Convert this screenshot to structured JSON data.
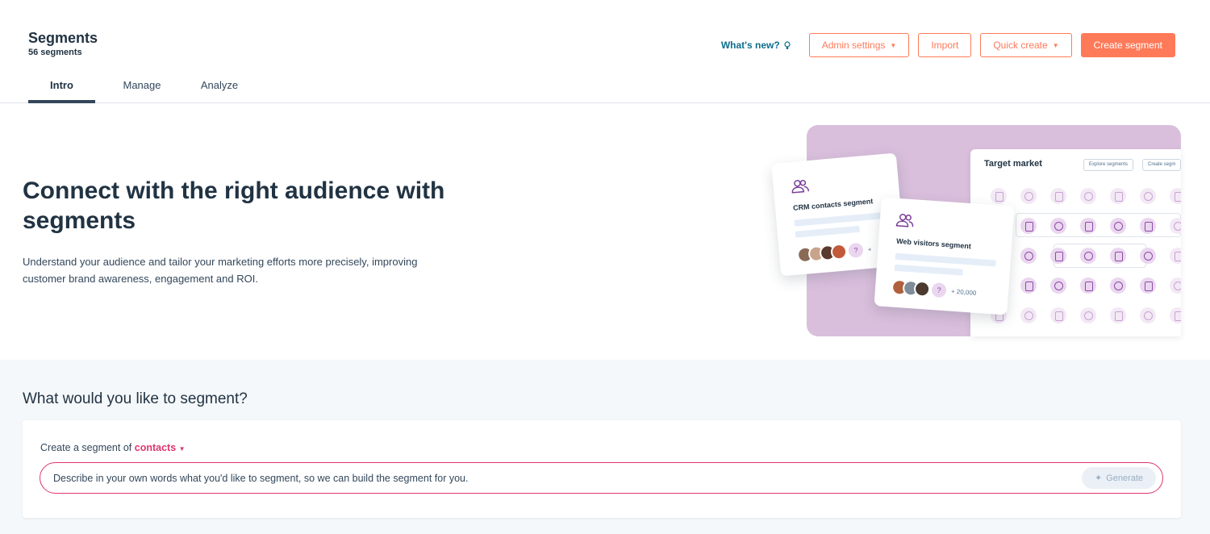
{
  "header": {
    "title": "Segments",
    "subtitle": "56 segments",
    "whats_new": "What's new?",
    "admin_settings": "Admin settings",
    "import": "Import",
    "quick_create": "Quick create",
    "create_segment": "Create segment"
  },
  "tabs": [
    {
      "label": "Intro",
      "active": true
    },
    {
      "label": "Manage",
      "active": false
    },
    {
      "label": "Analyze",
      "active": false
    }
  ],
  "hero": {
    "title": "Connect with the right audience with segments",
    "description": "Understand your audience and tailor your marketing efforts more precisely, improving customer brand awareness, engagement and ROI."
  },
  "illustration": {
    "target_title": "Target market",
    "explore_btn": "Explore segments",
    "create_btn": "Create segm",
    "card1_label": "CRM contacts segment",
    "card2_label": "Web visitors segment",
    "card2_count": "+ 20,000",
    "card1_count": "+"
  },
  "segment_builder": {
    "heading": "What would you like to segment?",
    "prefix": "Create a segment of",
    "object": "contacts",
    "placeholder": "Describe in your own words what you'd like to segment, so we can build the segment for you.",
    "generate": "Generate"
  },
  "colors": {
    "accent": "#ff7a59",
    "link": "#0b6e8c",
    "pink": "#e0366f",
    "illustration_bg": "#d9bfdc"
  }
}
